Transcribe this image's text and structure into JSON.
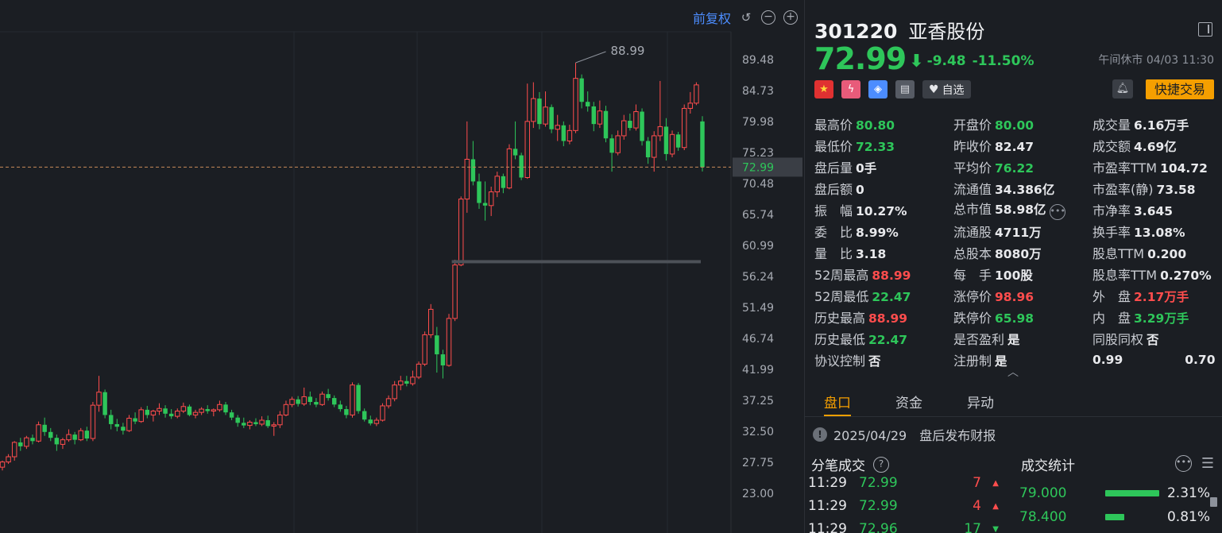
{
  "toolbar": {
    "adjust_label": "前复权"
  },
  "chart_data": {
    "type": "candlestick",
    "y_ticks": [
      "89.48",
      "84.73",
      "79.98",
      "75.23",
      "70.48",
      "65.74",
      "60.99",
      "56.24",
      "51.49",
      "46.74",
      "41.99",
      "37.25",
      "32.50",
      "27.75",
      "23.00"
    ],
    "ylim": [
      23.0,
      89.48
    ],
    "high_annotation": "88.99",
    "current_price_label": "72.99",
    "support_level": 58.5,
    "up_color": "#ff4d4d",
    "down_color": "#2ec65a",
    "candles": [
      [
        27.0,
        28.0,
        26.5,
        27.8
      ],
      [
        27.8,
        29.0,
        27.5,
        28.6
      ],
      [
        28.6,
        31.0,
        28.0,
        30.8
      ],
      [
        30.8,
        31.5,
        29.5,
        30.2
      ],
      [
        30.2,
        31.8,
        29.8,
        31.5
      ],
      [
        31.5,
        32.0,
        30.5,
        31.0
      ],
      [
        31.0,
        34.0,
        30.8,
        33.5
      ],
      [
        33.5,
        34.6,
        31.8,
        32.4
      ],
      [
        32.4,
        33.0,
        31.0,
        31.5
      ],
      [
        31.5,
        32.0,
        29.5,
        30.5
      ],
      [
        30.5,
        31.5,
        29.8,
        31.2
      ],
      [
        31.2,
        32.8,
        30.9,
        32.0
      ],
      [
        32.0,
        32.4,
        30.5,
        31.2
      ],
      [
        31.2,
        33.0,
        31.0,
        32.6
      ],
      [
        32.6,
        33.2,
        31.0,
        31.4
      ],
      [
        31.4,
        37.0,
        31.0,
        36.5
      ],
      [
        36.5,
        41.0,
        35.5,
        38.5
      ],
      [
        38.5,
        38.9,
        34.5,
        35.0
      ],
      [
        35.0,
        35.8,
        32.8,
        33.6
      ],
      [
        33.6,
        34.4,
        32.5,
        33.2
      ],
      [
        33.2,
        33.8,
        32.0,
        32.6
      ],
      [
        32.6,
        35.0,
        32.4,
        34.5
      ],
      [
        34.5,
        35.4,
        33.6,
        34.0
      ],
      [
        34.0,
        36.2,
        33.8,
        35.8
      ],
      [
        35.8,
        36.4,
        34.5,
        35.0
      ],
      [
        35.0,
        35.8,
        34.0,
        35.6
      ],
      [
        35.6,
        36.8,
        35.0,
        36.0
      ],
      [
        36.0,
        36.5,
        34.6,
        35.2
      ],
      [
        35.2,
        35.9,
        34.4,
        34.8
      ],
      [
        34.8,
        36.0,
        34.5,
        35.6
      ],
      [
        35.6,
        36.9,
        35.3,
        36.3
      ],
      [
        36.3,
        36.6,
        34.8,
        35.0
      ],
      [
        35.0,
        35.8,
        34.5,
        35.4
      ],
      [
        35.4,
        36.2,
        35.0,
        35.9
      ],
      [
        35.9,
        36.5,
        35.2,
        35.6
      ],
      [
        35.6,
        36.0,
        34.8,
        35.8
      ],
      [
        35.8,
        37.2,
        35.5,
        36.6
      ],
      [
        36.6,
        37.0,
        35.0,
        35.4
      ],
      [
        35.4,
        35.8,
        34.2,
        34.6
      ],
      [
        34.6,
        35.0,
        33.2,
        33.8
      ],
      [
        33.8,
        34.6,
        33.0,
        33.4
      ],
      [
        33.4,
        34.2,
        32.8,
        33.9
      ],
      [
        33.9,
        34.5,
        33.3,
        33.6
      ],
      [
        33.6,
        34.8,
        33.3,
        34.2
      ],
      [
        34.2,
        34.9,
        33.0,
        33.3
      ],
      [
        33.3,
        33.9,
        31.8,
        33.5
      ],
      [
        33.5,
        35.6,
        33.0,
        35.0
      ],
      [
        35.0,
        37.2,
        34.8,
        36.6
      ],
      [
        36.6,
        37.8,
        36.2,
        37.4
      ],
      [
        37.4,
        37.9,
        36.3,
        36.7
      ],
      [
        36.7,
        39.2,
        36.4,
        37.8
      ],
      [
        37.8,
        38.6,
        36.5,
        37.0
      ],
      [
        37.0,
        37.6,
        36.2,
        36.6
      ],
      [
        36.6,
        38.6,
        36.4,
        38.2
      ],
      [
        38.2,
        39.0,
        37.2,
        37.6
      ],
      [
        37.6,
        38.0,
        36.2,
        36.6
      ],
      [
        36.6,
        37.2,
        35.5,
        35.9
      ],
      [
        35.9,
        36.4,
        34.5,
        35.0
      ],
      [
        35.0,
        40.0,
        34.6,
        39.6
      ],
      [
        39.6,
        39.9,
        35.2,
        35.6
      ],
      [
        35.6,
        36.0,
        34.0,
        34.3
      ],
      [
        34.3,
        34.9,
        33.4,
        33.7
      ],
      [
        33.7,
        34.6,
        33.3,
        34.2
      ],
      [
        34.2,
        36.8,
        34.0,
        36.4
      ],
      [
        36.4,
        38.0,
        36.0,
        37.5
      ],
      [
        37.5,
        40.2,
        37.1,
        39.6
      ],
      [
        39.6,
        41.0,
        38.8,
        40.2
      ],
      [
        40.2,
        41.0,
        39.4,
        39.8
      ],
      [
        39.8,
        41.8,
        39.5,
        40.8
      ],
      [
        40.8,
        43.2,
        40.5,
        42.8
      ],
      [
        42.8,
        47.8,
        42.5,
        47.3
      ],
      [
        47.3,
        52.0,
        46.8,
        51.2
      ],
      [
        47.2,
        48.5,
        41.5,
        44.3
      ],
      [
        44.3,
        45.0,
        40.6,
        42.6
      ],
      [
        42.6,
        50.5,
        42.4,
        49.8
      ],
      [
        49.8,
        58.8,
        49.4,
        58.0
      ],
      [
        58.0,
        68.5,
        57.8,
        68.1
      ],
      [
        68.1,
        80.0,
        66.0,
        74.2
      ],
      [
        74.2,
        77.0,
        70.2,
        70.8
      ],
      [
        70.8,
        72.0,
        66.6,
        67.5
      ],
      [
        67.5,
        70.8,
        64.8,
        67.1
      ],
      [
        67.1,
        70.0,
        65.5,
        69.2
      ],
      [
        69.2,
        72.3,
        68.4,
        71.6
      ],
      [
        71.6,
        72.0,
        69.0,
        69.8
      ],
      [
        69.8,
        76.5,
        69.6,
        75.8
      ],
      [
        75.8,
        80.0,
        74.2,
        74.8
      ],
      [
        74.8,
        75.2,
        71.0,
        71.4
      ],
      [
        71.4,
        85.8,
        71.2,
        80.0
      ],
      [
        80.0,
        86.0,
        79.0,
        83.5
      ],
      [
        83.5,
        84.5,
        78.8,
        79.6
      ],
      [
        79.6,
        84.6,
        79.2,
        82.2
      ],
      [
        82.2,
        82.6,
        78.2,
        78.8
      ],
      [
        78.8,
        81.0,
        77.0,
        79.4
      ],
      [
        79.4,
        80.0,
        76.2,
        77.0
      ],
      [
        77.0,
        79.5,
        76.5,
        78.6
      ],
      [
        78.6,
        88.99,
        78.2,
        86.6
      ],
      [
        86.6,
        87.2,
        82.0,
        83.0
      ],
      [
        83.0,
        84.6,
        81.5,
        82.3
      ],
      [
        82.3,
        83.0,
        78.5,
        79.6
      ],
      [
        79.6,
        83.2,
        79.0,
        81.6
      ],
      [
        81.6,
        82.4,
        76.8,
        77.4
      ],
      [
        77.4,
        78.0,
        72.3,
        75.2
      ],
      [
        75.2,
        78.6,
        74.8,
        77.8
      ],
      [
        77.8,
        81.0,
        77.2,
        80.1
      ],
      [
        80.1,
        81.2,
        78.6,
        79.0
      ],
      [
        79.0,
        82.6,
        78.6,
        81.5
      ],
      [
        81.5,
        82.0,
        76.3,
        77.0
      ],
      [
        77.0,
        77.6,
        73.5,
        74.5
      ],
      [
        74.5,
        78.5,
        72.3,
        77.8
      ],
      [
        77.8,
        86.2,
        77.0,
        79.2
      ],
      [
        79.2,
        80.5,
        74.0,
        75.0
      ],
      [
        75.0,
        78.6,
        74.5,
        78.0
      ],
      [
        78.0,
        78.4,
        75.5,
        76.0
      ],
      [
        76.0,
        82.6,
        75.6,
        82.0
      ],
      [
        82.0,
        84.5,
        81.2,
        82.8
      ],
      [
        82.8,
        86.0,
        82.5,
        85.6
      ],
      [
        80.0,
        80.8,
        72.33,
        72.99
      ]
    ]
  },
  "quote": {
    "code": "301220",
    "name": "亚香股份",
    "price": "72.99",
    "arrow": "⬇",
    "change": "-9.48",
    "change_pct": "-11.50%",
    "session": "午间休市 04/03 11:30"
  },
  "badges": {
    "watch_label": "自选",
    "trade_label": "快捷交易"
  },
  "stats": [
    [
      {
        "label": "最高价",
        "value": "80.80",
        "color": "green"
      },
      {
        "label": "开盘价",
        "value": "80.00",
        "color": "green"
      },
      {
        "label": "成交量",
        "value": "6.16万手",
        "color": "white"
      }
    ],
    [
      {
        "label": "最低价",
        "value": "72.33",
        "color": "green"
      },
      {
        "label": "昨收价",
        "value": "82.47",
        "color": "white"
      },
      {
        "label": "成交额",
        "value": "4.69亿",
        "color": "white"
      }
    ],
    [
      {
        "label": "盘后量",
        "value": "0手",
        "color": "white"
      },
      {
        "label": "平均价",
        "value": "76.22",
        "color": "green"
      },
      {
        "label": "市盈率TTM",
        "value": "104.72",
        "color": "white"
      }
    ],
    [
      {
        "label": "盘后额",
        "value": "0",
        "color": "white"
      },
      {
        "label": "流通值",
        "value": "34.386亿",
        "color": "white"
      },
      {
        "label": "市盈率(静)",
        "value": "73.58",
        "color": "white"
      }
    ],
    [
      {
        "label": "振　幅",
        "value": "10.27%",
        "color": "white"
      },
      {
        "label": "总市值",
        "value": "58.98亿",
        "color": "white",
        "more": true
      },
      {
        "label": "市净率",
        "value": "3.645",
        "color": "white"
      }
    ],
    [
      {
        "label": "委　比",
        "value": "8.99%",
        "color": "white"
      },
      {
        "label": "流通股",
        "value": "4711万",
        "color": "white"
      },
      {
        "label": "换手率",
        "value": "13.08%",
        "color": "white"
      }
    ],
    [
      {
        "label": "量　比",
        "value": "3.18",
        "color": "white"
      },
      {
        "label": "总股本",
        "value": "8080万",
        "color": "white"
      },
      {
        "label": "股息TTM",
        "value": "0.200",
        "color": "white"
      }
    ],
    [
      {
        "label": "52周最高",
        "value": "88.99",
        "color": "red"
      },
      {
        "label": "每　手",
        "value": "100股",
        "color": "white"
      },
      {
        "label": "股息率TTM",
        "value": "0.270%",
        "color": "white"
      }
    ],
    [
      {
        "label": "52周最低",
        "value": "22.47",
        "color": "green"
      },
      {
        "label": "涨停价",
        "value": "98.96",
        "color": "red"
      },
      {
        "label": "外　盘",
        "value": "2.17万手",
        "color": "red"
      }
    ],
    [
      {
        "label": "历史最高",
        "value": "88.99",
        "color": "red"
      },
      {
        "label": "跌停价",
        "value": "65.98",
        "color": "green"
      },
      {
        "label": "内　盘",
        "value": "3.29万手",
        "color": "green"
      }
    ],
    [
      {
        "label": "历史最低",
        "value": "22.47",
        "color": "green"
      },
      {
        "label": "是否盈利",
        "value": "是",
        "color": "white"
      },
      {
        "label": "同股同权",
        "value": "否",
        "color": "white"
      }
    ],
    [
      {
        "label": "协议控制",
        "value": "否",
        "color": "white"
      },
      {
        "label": "注册制",
        "value": "是",
        "color": "white"
      },
      {
        "label": "",
        "value": "0.99",
        "color": "white",
        "extra": "0.70"
      }
    ]
  ],
  "tabs": [
    "盘口",
    "资金",
    "异动"
  ],
  "notice": "2025/04/29　盘后发布财报",
  "ticks_title": "分笔成交",
  "ticks": [
    {
      "time": "11:29",
      "price": "72.99",
      "vol": "7",
      "dir": "up"
    },
    {
      "time": "11:29",
      "price": "72.99",
      "vol": "4",
      "dir": "up"
    },
    {
      "time": "11:29",
      "price": "72.96",
      "vol": "17",
      "dir": "down"
    }
  ],
  "volstats_title": "成交统计",
  "volstats": [
    {
      "price": "79.000",
      "pct": "2.31%",
      "fill": 0.85
    },
    {
      "price": "78.400",
      "pct": "0.81%",
      "fill": 0.3
    }
  ]
}
